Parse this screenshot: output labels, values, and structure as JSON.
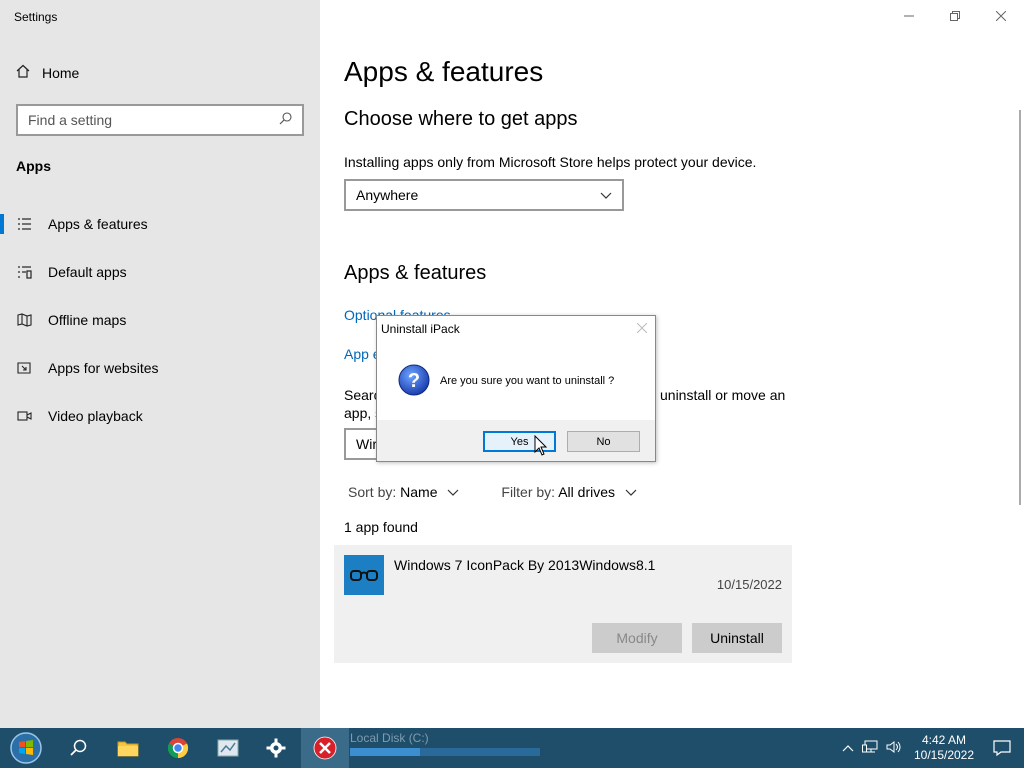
{
  "window": {
    "title": "Settings"
  },
  "sidebar": {
    "home_label": "Home",
    "search_placeholder": "Find a setting",
    "section_label": "Apps",
    "items": [
      {
        "label": "Apps & features",
        "icon": "list-icon",
        "active": true
      },
      {
        "label": "Default apps",
        "icon": "default-apps-icon"
      },
      {
        "label": "Offline maps",
        "icon": "map-icon"
      },
      {
        "label": "Apps for websites",
        "icon": "link-icon"
      },
      {
        "label": "Video playback",
        "icon": "video-icon"
      }
    ]
  },
  "main": {
    "title": "Apps & features",
    "choose_heading": "Choose where to get apps",
    "choose_desc": "Installing apps only from Microsoft Store helps protect your device.",
    "source_value": "Anywhere",
    "apps_heading": "Apps & features",
    "optional_features_link": "Optional features",
    "app_execution_link": "App e",
    "search_desc_left": "Searc",
    "search_desc_right": "uninstall or move an",
    "search_desc_line2": "app, s",
    "apps_search_value": "Wir",
    "sort_label": "Sort by:",
    "sort_value": "Name",
    "filter_label": "Filter by:",
    "filter_value": "All drives",
    "count_text": "1 app found",
    "apps": [
      {
        "name": "Windows 7 IconPack By 2013Windows8.1",
        "date": "10/15/2022",
        "modify_label": "Modify",
        "uninstall_label": "Uninstall"
      }
    ]
  },
  "dialog": {
    "title": "Uninstall iPack",
    "message": "Are you sure you want to uninstall ?",
    "yes_label": "Yes",
    "no_label": "No"
  },
  "taskbar": {
    "bg_window_text": "Local Disk (C:)",
    "clock_time": "4:42 AM",
    "clock_date": "10/15/2022"
  }
}
